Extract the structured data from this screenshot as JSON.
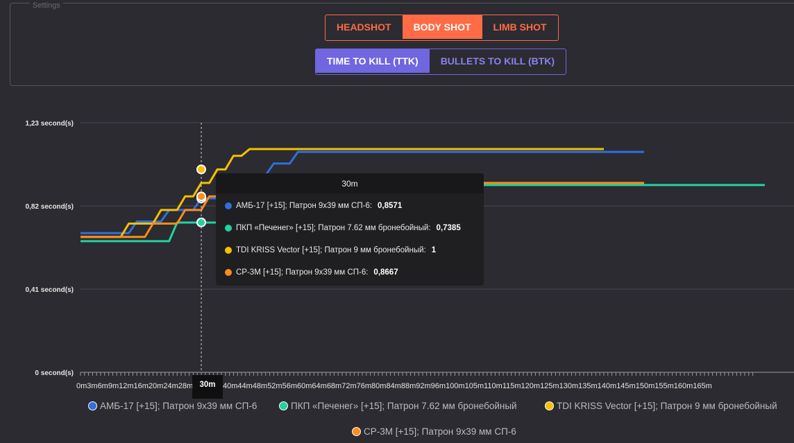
{
  "settings": {
    "legend": "Settings",
    "shot_buttons": [
      {
        "label": "HEADSHOT",
        "active": false
      },
      {
        "label": "BODY SHOT",
        "active": true
      },
      {
        "label": "LIMB SHOT",
        "active": false
      }
    ],
    "metric_buttons": [
      {
        "label": "TIME TO KILL (TTK)",
        "active": true
      },
      {
        "label": "BULLETS TO KILL (BTK)",
        "active": false
      }
    ]
  },
  "colors": {
    "accent_orange": "#ff6b45",
    "accent_purple": "#7066e0"
  },
  "tooltip": {
    "title": "30m",
    "rows": [
      {
        "label": "АМБ-17 [+15]; Патрон 9х39 мм СП-6:",
        "value": "0,8571",
        "color": "#2f6fe0"
      },
      {
        "label": "ПКП «Печенег» [+15]; Патрон 7.62 мм бронебойный:",
        "value": "0,7385",
        "color": "#22d3a0"
      },
      {
        "label": "TDI KRISS Vector [+15]; Патрон 9 мм бронебойный:",
        "value": "1",
        "color": "#f5c000"
      },
      {
        "label": "СР-3М [+15]; Патрон 9х39 мм СП-6:",
        "value": "0,8667",
        "color": "#ff8c1a"
      }
    ]
  },
  "hover_x_label": "30m",
  "chart_data": {
    "type": "line",
    "x_unit": "m",
    "y_unit": "second(s)",
    "yticks": [
      "0 second(s)",
      "0,41 second(s)",
      "0,82 second(s)",
      "1,23 second(s)"
    ],
    "ylim": [
      0,
      1.23
    ],
    "xlim": [
      0,
      167
    ],
    "x_tick_labels": [
      "0m",
      "3m",
      "6m",
      "9m",
      "12m",
      "16m",
      "20m",
      "24m",
      "28m",
      "30m",
      "36m",
      "40m",
      "44m",
      "48m",
      "52m",
      "56m",
      "60m",
      "64m",
      "68m",
      "72m",
      "76m",
      "80m",
      "84m",
      "88m",
      "92m",
      "96m",
      "100m",
      "105m",
      "110m",
      "115m",
      "120m",
      "125m",
      "130m",
      "135m",
      "140m",
      "145m",
      "150m",
      "155m",
      "160m",
      "165m"
    ],
    "hover_x": 30,
    "grid": true,
    "legend_position": "bottom",
    "series": [
      {
        "name": "АМБ-17 [+15]; Патрон 9х39 мм СП-6",
        "color": "#2f6fe0",
        "points": [
          [
            0,
            0.686
          ],
          [
            12,
            0.686
          ],
          [
            14,
            0.743
          ],
          [
            20,
            0.743
          ],
          [
            22,
            0.8
          ],
          [
            28,
            0.8
          ],
          [
            30,
            0.857
          ],
          [
            36,
            0.857
          ],
          [
            38,
            0.914
          ],
          [
            40,
            0.914
          ],
          [
            42,
            0.971
          ],
          [
            46,
            0.971
          ],
          [
            48,
            1.029
          ],
          [
            52,
            1.029
          ],
          [
            54,
            1.086
          ],
          [
            140,
            1.086
          ]
        ]
      },
      {
        "name": "ПКП «Печенег» [+15]; Патрон 7.62 мм бронебойный",
        "color": "#22d3a0",
        "points": [
          [
            0,
            0.646
          ],
          [
            22,
            0.646
          ],
          [
            24,
            0.738
          ],
          [
            40,
            0.738
          ],
          [
            42,
            0.786
          ],
          [
            46,
            0.786
          ],
          [
            48,
            0.835
          ],
          [
            54,
            0.835
          ],
          [
            56,
            0.923
          ],
          [
            170,
            0.923
          ]
        ]
      },
      {
        "name": "TDI KRISS Vector [+15]; Патрон 9 мм бронебойный",
        "color": "#f5c000",
        "points": [
          [
            0,
            0.667
          ],
          [
            10,
            0.667
          ],
          [
            12,
            0.733
          ],
          [
            18,
            0.733
          ],
          [
            20,
            0.8
          ],
          [
            24,
            0.8
          ],
          [
            26,
            0.867
          ],
          [
            28,
            0.867
          ],
          [
            30,
            0.933
          ],
          [
            32,
            0.933
          ],
          [
            34,
            1.0
          ],
          [
            36,
            1.0
          ],
          [
            38,
            1.067
          ],
          [
            40,
            1.067
          ],
          [
            42,
            1.1
          ],
          [
            130,
            1.1
          ]
        ]
      },
      {
        "name": "СР-3М [+15]; Патрон 9х39 мм СП-6",
        "color": "#ff8c1a",
        "points": [
          [
            0,
            0.667
          ],
          [
            16,
            0.667
          ],
          [
            18,
            0.733
          ],
          [
            24,
            0.733
          ],
          [
            26,
            0.8
          ],
          [
            30,
            0.8
          ],
          [
            32,
            0.867
          ],
          [
            46,
            0.867
          ],
          [
            48,
            0.933
          ],
          [
            140,
            0.933
          ]
        ]
      }
    ],
    "hover_points": [
      {
        "series": 0,
        "y": 0.8571
      },
      {
        "series": 1,
        "y": 0.7385
      },
      {
        "series": 2,
        "y": 1.0
      },
      {
        "series": 3,
        "y": 0.8667
      }
    ]
  },
  "legend_items": [
    {
      "label": "АМБ-17 [+15]; Патрон 9х39 мм СП-6",
      "color": "#2f6fe0"
    },
    {
      "label": "ПКП «Печенег» [+15]; Патрон 7.62 мм бронебойный",
      "color": "#22d3a0"
    },
    {
      "label": "TDI KRISS Vector [+15]; Патрон 9 мм бронебойный",
      "color": "#f5c000"
    },
    {
      "label": "СР-3М [+15]; Патрон 9х39 мм СП-6",
      "color": "#ff8c1a"
    }
  ]
}
